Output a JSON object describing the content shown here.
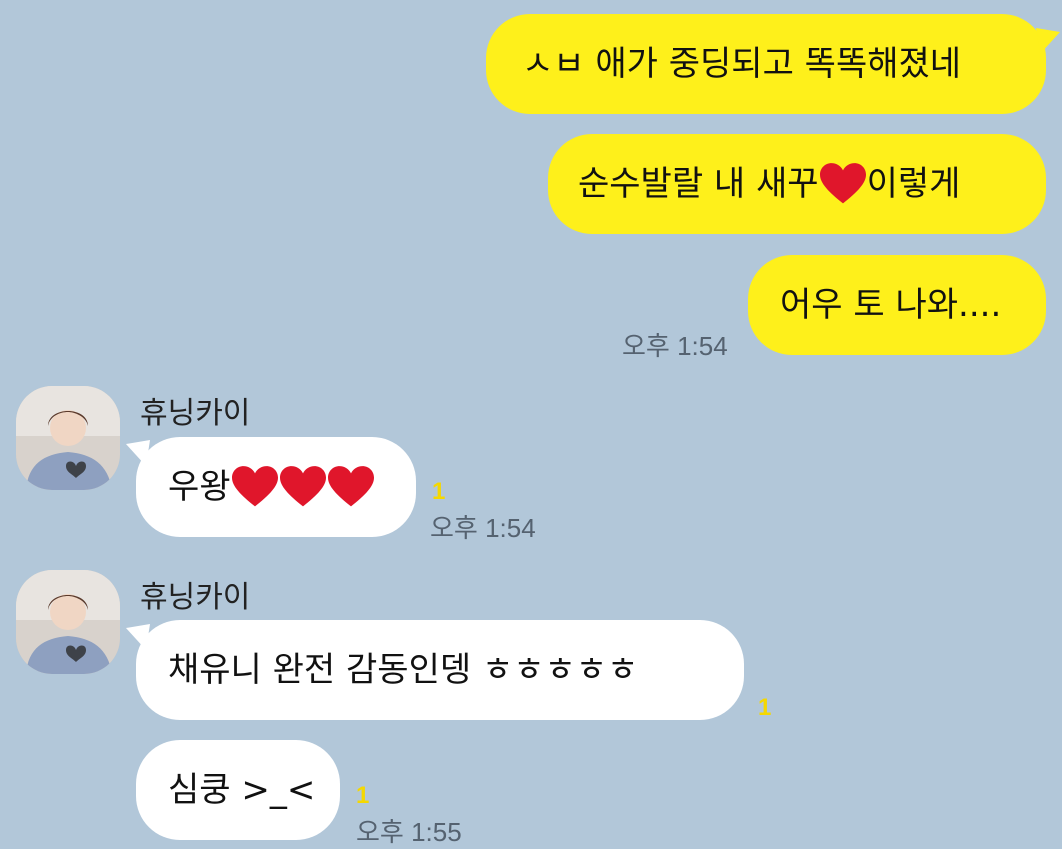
{
  "messages_mine": [
    {
      "text": "ㅅㅂ 애가 중딩되고 똑똑해졌네"
    },
    {
      "text_before": "순수발랄 내 새꾸",
      "emoji": "heart-icon",
      "text_after": " 이렇게"
    },
    {
      "text": "어우 토 나와....",
      "time": "오후 1:54"
    }
  ],
  "group1": {
    "sender": "휴닝카이",
    "message": {
      "text": "우왕",
      "emoji_count": 3,
      "unread": "1",
      "time": "오후 1:54"
    }
  },
  "group2": {
    "sender": "휴닝카이",
    "messages": [
      {
        "text": "채유니 완전 감동인뎅 ㅎㅎㅎㅎㅎ",
        "unread": "1"
      },
      {
        "text": "심쿵 >_<",
        "unread": "1",
        "time": "오후 1:55"
      }
    ]
  },
  "colors": {
    "background": "#b2c7d9",
    "my_bubble": "#fef01b",
    "their_bubble": "#ffffff",
    "unread": "#f5d800",
    "heart": "#e0162b"
  }
}
